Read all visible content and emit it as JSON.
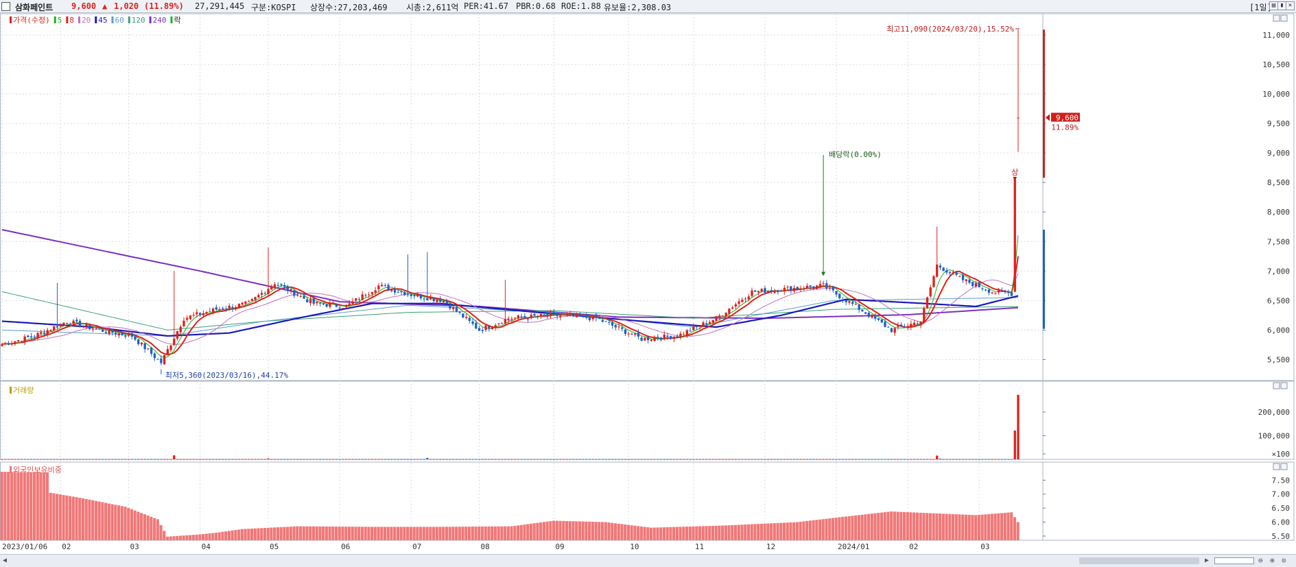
{
  "header": {
    "stock_name": "삼화페인트",
    "price": "9,600",
    "change_arrow": "▲",
    "change": "1,020",
    "change_pct": "(11.89%)",
    "volume": "27,291,445",
    "market": "구분:KOSPI",
    "shares": "상장수:27,203,469",
    "market_cap": "시총:2,611억",
    "per": "PER:41.67",
    "pbr": "PBR:0.68",
    "roe": "ROE:1.88",
    "reserve": "유보율:2,308.03",
    "period": "[1일]",
    "window_buttons": [
      "▤",
      "▮",
      "✕"
    ]
  },
  "colors": {
    "up": "#e0201b",
    "down": "#1d5fd0",
    "ma5": "#1fb21f",
    "ma8": "#e0201b",
    "ma20": "#c070c0",
    "ma45": "#1a1ab8",
    "ma60": "#5aa0c8",
    "ma120": "#38a078",
    "ma240": "#7c2fbd",
    "volume_text": "#b8a000",
    "foreign_bar": "#f07878",
    "grid": "#d6dbe3"
  },
  "chart_data": [
    {
      "type": "candlestick",
      "title": "가격(수정)",
      "legend": [
        {
          "label": "가격(수정)",
          "color": "#e0201b"
        },
        {
          "label": "5",
          "color": "#1fb21f"
        },
        {
          "label": "8",
          "color": "#e0201b"
        },
        {
          "label": "20",
          "color": "#c070c0"
        },
        {
          "label": "45",
          "color": "#1a1ab8"
        },
        {
          "label": "60",
          "color": "#5aa0c8"
        },
        {
          "label": "120",
          "color": "#38a078"
        },
        {
          "label": "240",
          "color": "#7c2fbd"
        },
        {
          "label": "락",
          "color": "#1fb21f"
        }
      ],
      "ylim": [
        5180,
        11220
      ],
      "y_ticks": [
        5500,
        6000,
        6500,
        7000,
        7500,
        8000,
        8500,
        9000,
        9500,
        10000,
        10500,
        11000
      ],
      "y_tick_labels": [
        "5,500",
        "6,000",
        "6,500",
        "7,000",
        "7,500",
        "8,000",
        "8,500",
        "9,000",
        "9,500",
        "10,000",
        "10,500",
        "11,000"
      ],
      "x_labels": [
        "2023/01/06",
        "02",
        "03",
        "04",
        "05",
        "06",
        "07",
        "08",
        "09",
        "10",
        "11",
        "12",
        "2024/01",
        "02",
        "03"
      ],
      "close_anchors": [
        [
          "2023-01-06",
          5760
        ],
        [
          "2023-01-20",
          5900
        ],
        [
          "2023-02-03",
          6150
        ],
        [
          "2023-02-17",
          6000
        ],
        [
          "2023-03-03",
          5900
        ],
        [
          "2023-03-16",
          5450
        ],
        [
          "2023-03-27",
          6200
        ],
        [
          "2023-04-10",
          6350
        ],
        [
          "2023-04-24",
          6450
        ],
        [
          "2023-05-04",
          6800
        ],
        [
          "2023-05-22",
          6450
        ],
        [
          "2023-06-05",
          6400
        ],
        [
          "2023-06-19",
          6750
        ],
        [
          "2023-07-03",
          6600
        ],
        [
          "2023-07-17",
          6500
        ],
        [
          "2023-08-01",
          6000
        ],
        [
          "2023-08-14",
          6200
        ],
        [
          "2023-09-01",
          6250
        ],
        [
          "2023-09-20",
          6200
        ],
        [
          "2023-10-10",
          5850
        ],
        [
          "2023-10-25",
          5900
        ],
        [
          "2023-11-10",
          6200
        ],
        [
          "2023-11-27",
          6650
        ],
        [
          "2023-12-12",
          6700
        ],
        [
          "2023-12-27",
          6750
        ],
        [
          "2024-01-10",
          6400
        ],
        [
          "2024-01-25",
          6000
        ],
        [
          "2024-02-07",
          6150
        ],
        [
          "2024-02-14",
          7100
        ],
        [
          "2024-02-26",
          6850
        ],
        [
          "2024-03-08",
          6650
        ],
        [
          "2024-03-18",
          6620
        ],
        [
          "2024-03-19",
          8580
        ],
        [
          "2024-03-20",
          9600
        ]
      ],
      "spikes": [
        {
          "date": "2023-01-31",
          "high": 6800
        },
        {
          "date": "2023-03-22",
          "high": 7000
        },
        {
          "date": "2023-05-02",
          "high": 7400
        },
        {
          "date": "2023-06-30",
          "high": 7280
        },
        {
          "date": "2023-07-10",
          "high": 7320
        },
        {
          "date": "2023-08-11",
          "high": 6850
        },
        {
          "date": "2024-02-14",
          "high": 7750
        }
      ],
      "last_candles": [
        {
          "date": "2024-03-19",
          "open": 6650,
          "high": 8580,
          "low": 6640,
          "close": 8580
        },
        {
          "date": "2024-03-20",
          "open": 9600,
          "high": 11090,
          "low": 9020,
          "close": 9600
        }
      ],
      "ma240_anchors": [
        [
          "2023-01-06",
          7700
        ],
        [
          "2023-04-03",
          7000
        ],
        [
          "2023-06-01",
          6480
        ],
        [
          "2023-08-01",
          6400
        ],
        [
          "2023-10-01",
          6220
        ],
        [
          "2023-12-01",
          6200
        ],
        [
          "2024-02-01",
          6260
        ],
        [
          "2024-03-20",
          6380
        ]
      ],
      "ma120_anchors": [
        [
          "2023-01-06",
          6650
        ],
        [
          "2023-03-20",
          6000
        ],
        [
          "2023-05-01",
          6150
        ],
        [
          "2023-07-01",
          6300
        ],
        [
          "2023-09-01",
          6330
        ],
        [
          "2023-11-01",
          6200
        ],
        [
          "2024-01-01",
          6350
        ],
        [
          "2024-03-20",
          6400
        ]
      ],
      "ma60_anchors": [
        [
          "2023-01-06",
          6000
        ],
        [
          "2023-03-20",
          5900
        ],
        [
          "2023-05-01",
          6150
        ],
        [
          "2023-07-01",
          6420
        ],
        [
          "2023-09-01",
          6300
        ],
        [
          "2023-11-01",
          6050
        ],
        [
          "2024-01-01",
          6500
        ],
        [
          "2024-03-20",
          6550
        ]
      ],
      "ma45_anchors": [
        [
          "2023-01-06",
          6150
        ],
        [
          "2023-02-15",
          6050
        ],
        [
          "2023-03-20",
          5900
        ],
        [
          "2023-04-15",
          5950
        ],
        [
          "2023-05-15",
          6200
        ],
        [
          "2023-06-15",
          6450
        ],
        [
          "2023-07-15",
          6450
        ],
        [
          "2023-08-25",
          6300
        ],
        [
          "2023-10-10",
          6150
        ],
        [
          "2023-11-10",
          6050
        ],
        [
          "2023-12-10",
          6250
        ],
        [
          "2024-01-05",
          6520
        ],
        [
          "2024-02-05",
          6460
        ],
        [
          "2024-03-01",
          6400
        ],
        [
          "2024-03-20",
          6580
        ]
      ],
      "annotations": {
        "high": "최고11,090(2024/03/20),15.52%",
        "low": "최저5,360(2023/03/16),44.17%",
        "dividend": "배당락(0.00%)",
        "limit_up": "상",
        "last_price": "9,600",
        "last_pct": "11.89%"
      }
    },
    {
      "type": "bar",
      "title": "거래량",
      "ylim": [
        0,
        290000
      ],
      "y_ticks": [
        100,
        100000,
        200000
      ],
      "y_tick_labels": [
        "×100",
        "100,000",
        "200,000"
      ],
      "base": 1200,
      "spikes": [
        {
          "date": "2023-03-22",
          "value": 17000
        },
        {
          "date": "2023-05-02",
          "value": 4000
        },
        {
          "date": "2023-07-10",
          "value": 6000
        },
        {
          "date": "2024-02-14",
          "value": 16000
        },
        {
          "date": "2024-02-15",
          "value": 3000
        },
        {
          "date": "2024-03-19",
          "value": 122000
        },
        {
          "date": "2024-03-20",
          "value": 272914
        }
      ]
    },
    {
      "type": "bar",
      "title": "외국인보유비중",
      "ylim": [
        5.35,
        7.95
      ],
      "y_ticks": [
        5.5,
        6.0,
        6.5,
        7.0,
        7.5
      ],
      "y_tick_labels": [
        "5.50",
        "6.00",
        "6.50",
        "7.00",
        "7.50"
      ],
      "anchors": [
        [
          "2023-01-06",
          7.8
        ],
        [
          "2023-01-26",
          7.78
        ],
        [
          "2023-01-27",
          7.05
        ],
        [
          "2023-02-10",
          6.85
        ],
        [
          "2023-03-01",
          6.55
        ],
        [
          "2023-03-15",
          6.1
        ],
        [
          "2023-03-20",
          5.48
        ],
        [
          "2023-04-01",
          5.55
        ],
        [
          "2023-04-10",
          5.62
        ],
        [
          "2023-04-20",
          5.75
        ],
        [
          "2023-05-15",
          5.85
        ],
        [
          "2023-06-15",
          5.83
        ],
        [
          "2023-07-15",
          5.83
        ],
        [
          "2023-08-15",
          5.85
        ],
        [
          "2023-09-01",
          6.05
        ],
        [
          "2023-09-25",
          6.0
        ],
        [
          "2023-10-15",
          5.8
        ],
        [
          "2023-11-15",
          5.88
        ],
        [
          "2023-12-15",
          6.0
        ],
        [
          "2024-01-05",
          6.2
        ],
        [
          "2024-01-25",
          6.38
        ],
        [
          "2024-02-12",
          6.32
        ],
        [
          "2024-03-01",
          6.25
        ],
        [
          "2024-03-18",
          6.35
        ],
        [
          "2024-03-20",
          6.0
        ]
      ]
    }
  ],
  "panels": {
    "volume_label": "거래량",
    "foreign_label": "외국인보유비중"
  },
  "scrollbar": {
    "left_arrow": "◀",
    "right_arrow": "▶",
    "zoom_icons": [
      "⊖",
      "⊕",
      "⊙"
    ]
  }
}
